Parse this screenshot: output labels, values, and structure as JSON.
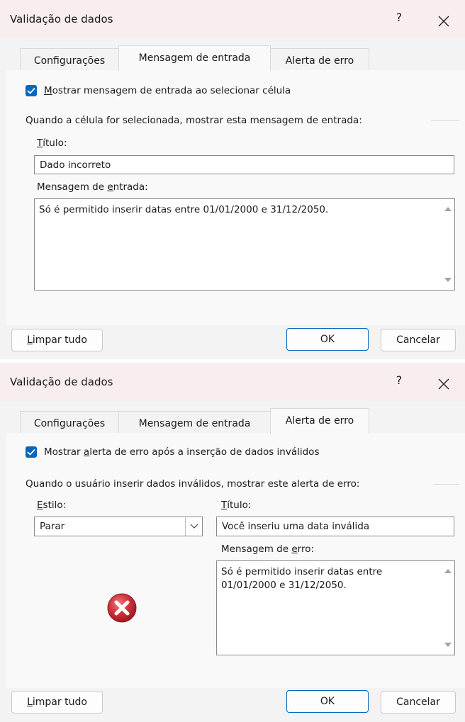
{
  "dialogs": [
    {
      "title": "Validação de dados",
      "help": "?",
      "tabs": [
        "Configurações",
        "Mensagem de entrada",
        "Alerta de erro"
      ],
      "active_tab": "Mensagem de entrada",
      "checkbox": {
        "checked": true,
        "mnemonic": "M",
        "rest": "ostrar mensagem de entrada ao selecionar célula"
      },
      "section": "Quando a célula for selecionada, mostrar esta mensagem de entrada:",
      "titulo_label": {
        "mnemonic": "T",
        "rest": "ítulo:"
      },
      "titulo_value": "Dado incorreto",
      "msg_label": {
        "pre": "Mensagem de ",
        "mnemonic": "e",
        "rest": "ntrada:"
      },
      "msg_value": "Só é permitido inserir datas entre 01/01/2000 e 31/12/2050.",
      "buttons": {
        "clear_mnemonic": "L",
        "clear_rest": "impar tudo",
        "ok": "OK",
        "cancel": "Cancelar"
      }
    },
    {
      "title": "Validação de dados",
      "help": "?",
      "tabs": [
        "Configurações",
        "Mensagem de entrada",
        "Alerta de erro"
      ],
      "active_tab": "Alerta de erro",
      "checkbox": {
        "checked": true,
        "pre": "Mostrar ",
        "mnemonic": "a",
        "rest": "lerta de erro após a inserção de dados inválidos"
      },
      "section": "Quando o usuário inserir dados inválidos, mostrar este alerta de erro:",
      "estilo_label": {
        "mnemonic": "E",
        "rest": "stilo:"
      },
      "estilo_value": "Parar",
      "titulo_label": {
        "mnemonic": "T",
        "rest": "ítulo:"
      },
      "titulo_value": "Você inseriu uma data inválida",
      "msg_label": {
        "pre": "Mensagem de ",
        "mnemonic": "e",
        "rest": "rro:"
      },
      "msg_value_lines": [
        "Só é permitido inserir datas entre",
        "01/01/2000 e 31/12/2050."
      ],
      "icon": "error-stop-icon",
      "buttons": {
        "clear_mnemonic": "L",
        "clear_rest": "impar tudo",
        "ok": "OK",
        "cancel": "Cancelar"
      }
    }
  ],
  "colors": {
    "accent": "#0067c0",
    "titlebar": "#f9eeee",
    "error_red": "#c4262e"
  }
}
